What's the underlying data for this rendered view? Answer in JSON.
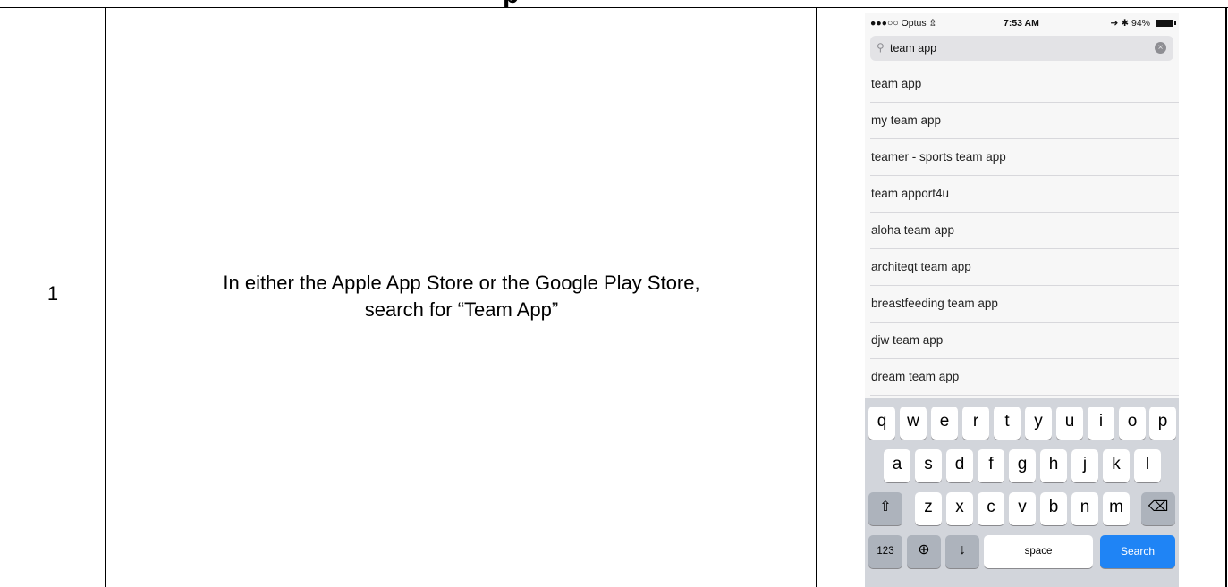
{
  "heading_fragment": "p",
  "row": {
    "number": "1",
    "instruction_line1": "In either the Apple App Store or the Google Play Store,",
    "instruction_line2": "search for “Team App”"
  },
  "phone": {
    "status": {
      "carrier": "●●●○○ Optus ⇯",
      "time": "7:53 AM",
      "battery": "➔ ✱ 94%"
    },
    "search": {
      "icon": "magnifier-icon",
      "query": "team app",
      "clear_icon": "clear-circle-icon"
    },
    "suggestions": [
      "team app",
      "my team app",
      "teamer - sports team app",
      "team apport4u",
      "aloha team app",
      "architeqt team app",
      "breastfeeding team app",
      "djw team app",
      "dream team app"
    ],
    "keyboard": {
      "row1": [
        "q",
        "w",
        "e",
        "r",
        "t",
        "y",
        "u",
        "i",
        "o",
        "p"
      ],
      "row2": [
        "a",
        "s",
        "d",
        "f",
        "g",
        "h",
        "j",
        "k",
        "l"
      ],
      "row3": [
        "z",
        "x",
        "c",
        "v",
        "b",
        "n",
        "m"
      ],
      "shift": "⇧",
      "backspace": "⌫",
      "numbers": "123",
      "globe": "⊕",
      "mic": "↓",
      "space": "space",
      "search": "Search"
    }
  }
}
